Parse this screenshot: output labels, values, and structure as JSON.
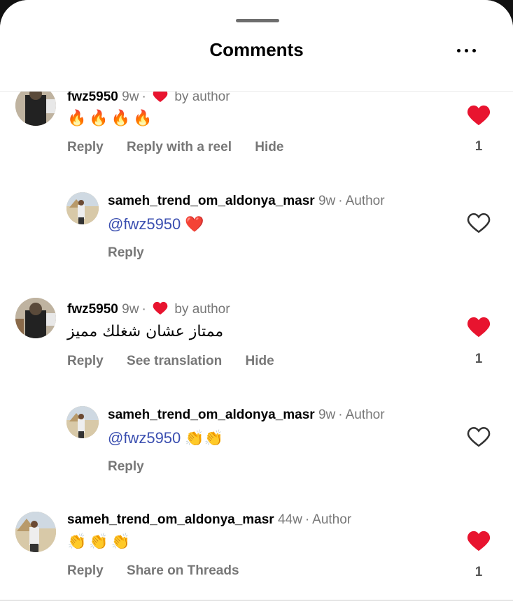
{
  "header": {
    "title": "Comments",
    "more_icon": "more-horizontal-icon"
  },
  "colors": {
    "heart": "#e8142f",
    "mention": "#3b4fb0",
    "muted": "#777777"
  },
  "comments": [
    {
      "username": "fwz5950",
      "time": "9w",
      "liked_by_author": true,
      "badge": "by author",
      "text": "🔥🔥🔥🔥",
      "actions": [
        "Reply",
        "Reply with a reel",
        "Hide"
      ],
      "liked": true,
      "likes": "1"
    },
    {
      "username": "sameh_trend_om_aldonya_masr",
      "time": "9w",
      "badge": "Author",
      "mention": "@fwz5950",
      "text": "❤️",
      "actions": [
        "Reply"
      ],
      "liked": false
    },
    {
      "username": "fwz5950",
      "time": "9w",
      "liked_by_author": true,
      "badge": "by author",
      "text": "ممتاز عشان شغلك مميز",
      "actions": [
        "Reply",
        "See translation",
        "Hide"
      ],
      "liked": true,
      "likes": "1"
    },
    {
      "username": "sameh_trend_om_aldonya_masr",
      "time": "9w",
      "badge": "Author",
      "mention": "@fwz5950",
      "text": "👏👏",
      "actions": [
        "Reply"
      ],
      "liked": false
    },
    {
      "username": "sameh_trend_om_aldonya_masr",
      "time": "44w",
      "badge": "Author",
      "text": "👏👏👏",
      "actions": [
        "Reply",
        "Share on Threads"
      ],
      "liked": true,
      "likes": "1"
    }
  ]
}
